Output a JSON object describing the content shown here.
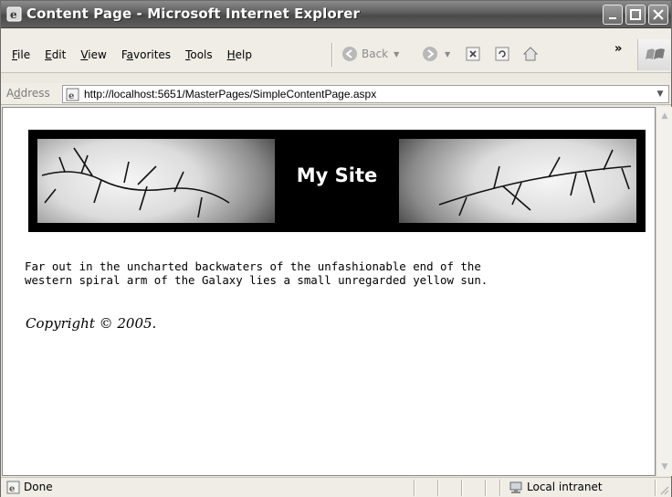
{
  "window": {
    "title": "Content Page - Microsoft Internet Explorer",
    "controls": {
      "minimize": "minimize-icon",
      "maximize": "maximize-icon",
      "close": "close-icon"
    }
  },
  "menubar": {
    "items": [
      {
        "accel": "F",
        "rest": "ile"
      },
      {
        "accel": "E",
        "rest": "dit"
      },
      {
        "accel": "V",
        "rest": "iew"
      },
      {
        "pre": "F",
        "accel": "a",
        "rest": "vorites"
      },
      {
        "accel": "T",
        "rest": "ools"
      },
      {
        "accel": "H",
        "rest": "elp"
      }
    ],
    "back_label": "Back",
    "overflow": "»"
  },
  "addressbar": {
    "label_pre": "A",
    "label_accel": "d",
    "label_rest": "dress",
    "url": "http://localhost:5651/MasterPages/SimpleContentPage.aspx"
  },
  "page": {
    "banner_title": "My Site",
    "body_text": "Far out in the uncharted backwaters of the unfashionable end of the\nwestern spiral arm of the Galaxy lies a small unregarded yellow sun.",
    "copyright": "Copyright © 2005."
  },
  "statusbar": {
    "status": "Done",
    "zone": "Local intranet"
  },
  "colors": {
    "titlebar": "#5c5c5c",
    "chrome": "#efede6",
    "banner_bg": "#000000"
  }
}
